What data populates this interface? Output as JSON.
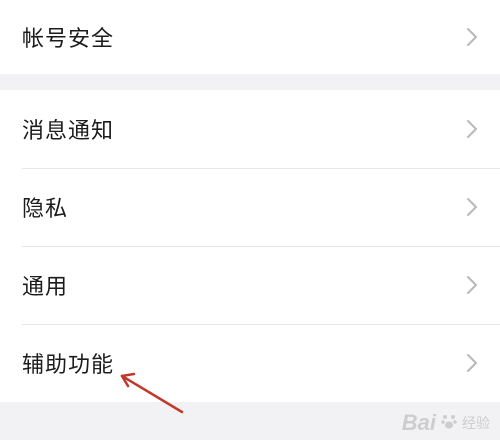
{
  "settings": {
    "group1": [
      {
        "label": "帐号安全",
        "icon": "chevron-right-icon"
      }
    ],
    "group2": [
      {
        "label": "消息通知",
        "icon": "chevron-right-icon"
      },
      {
        "label": "隐私",
        "icon": "chevron-right-icon"
      },
      {
        "label": "通用",
        "icon": "chevron-right-icon"
      },
      {
        "label": "辅助功能",
        "icon": "chevron-right-icon"
      }
    ]
  },
  "annotation": {
    "icon": "red-arrow-icon",
    "color": "#c0392b"
  },
  "watermark": {
    "brand": "Bai",
    "sub": "经验"
  },
  "colors": {
    "background": "#f2f2f5",
    "card": "#ffffff",
    "divider": "#e6e6e8",
    "text": "#1c1c1e",
    "chevron": "#b8b8bd"
  }
}
